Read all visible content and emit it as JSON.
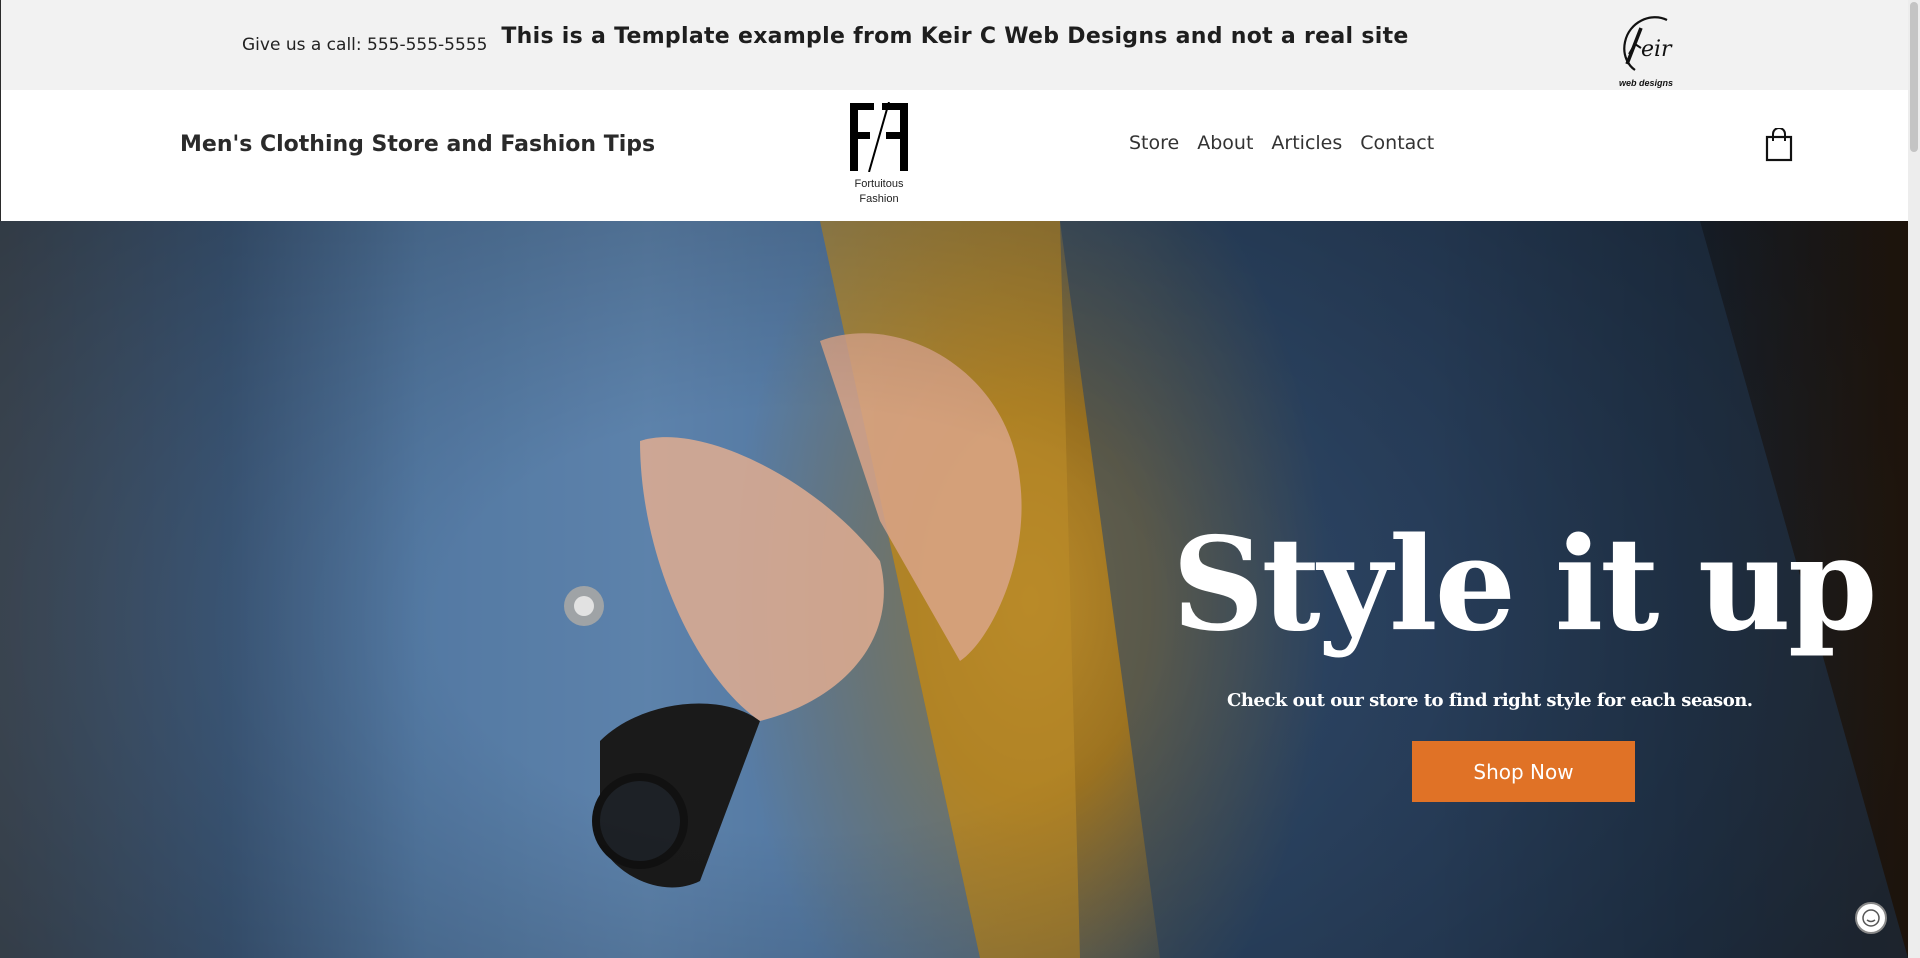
{
  "topbar": {
    "phone": "Give us a call: 555-555-5555",
    "notice": "This is a Template example from Keir C Web Designs and not a real site",
    "keir_logo": {
      "mark": "eir",
      "tagline": "web designs"
    }
  },
  "header": {
    "site_title": "Men's Clothing Store and Fashion Tips",
    "brand": {
      "line1": "Fortuitous",
      "line2": "Fashion"
    },
    "nav": [
      "Store",
      "About",
      "Articles",
      "Contact"
    ],
    "cart_icon": "shopping-bag-icon"
  },
  "hero": {
    "title": "Style it up",
    "subtitle": "Check out our store to find right style for each season.",
    "button_label": "Shop Now"
  },
  "colors": {
    "topbar_bg": "#f2f2f2",
    "accent": "#e07226",
    "hero_text": "#ffffff"
  },
  "icons": [
    "keir-logo-icon",
    "ff-logo-icon",
    "shopping-bag-icon",
    "chat-icon"
  ]
}
